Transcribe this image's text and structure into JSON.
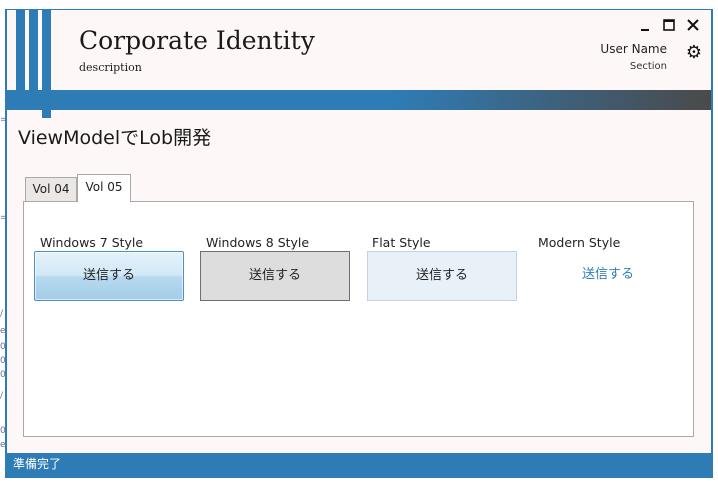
{
  "header": {
    "brand_title": "Corporate Identity",
    "brand_description": "description",
    "user_name": "User Name",
    "user_section": "Section"
  },
  "window_controls": {
    "minimize_icon": "minimize-icon",
    "maximize_icon": "maximize-icon",
    "close_icon": "close-icon"
  },
  "page_title": "ViewModelでLob開発",
  "tabs": [
    {
      "label": "Vol 04",
      "selected": false
    },
    {
      "label": "Vol 05",
      "selected": true
    }
  ],
  "styles": [
    {
      "label": "Windows 7 Style",
      "button": "送信する"
    },
    {
      "label": "Windows 8 Style",
      "button": "送信する"
    },
    {
      "label": "Flat Style",
      "button": "送信する"
    },
    {
      "label": "Modern Style",
      "button": "送信する"
    }
  ],
  "status": "準備完了",
  "colors": {
    "accent": "#2e7cb6",
    "client_background": "#fdf8f7",
    "modern_link": "#2e7cb6"
  }
}
